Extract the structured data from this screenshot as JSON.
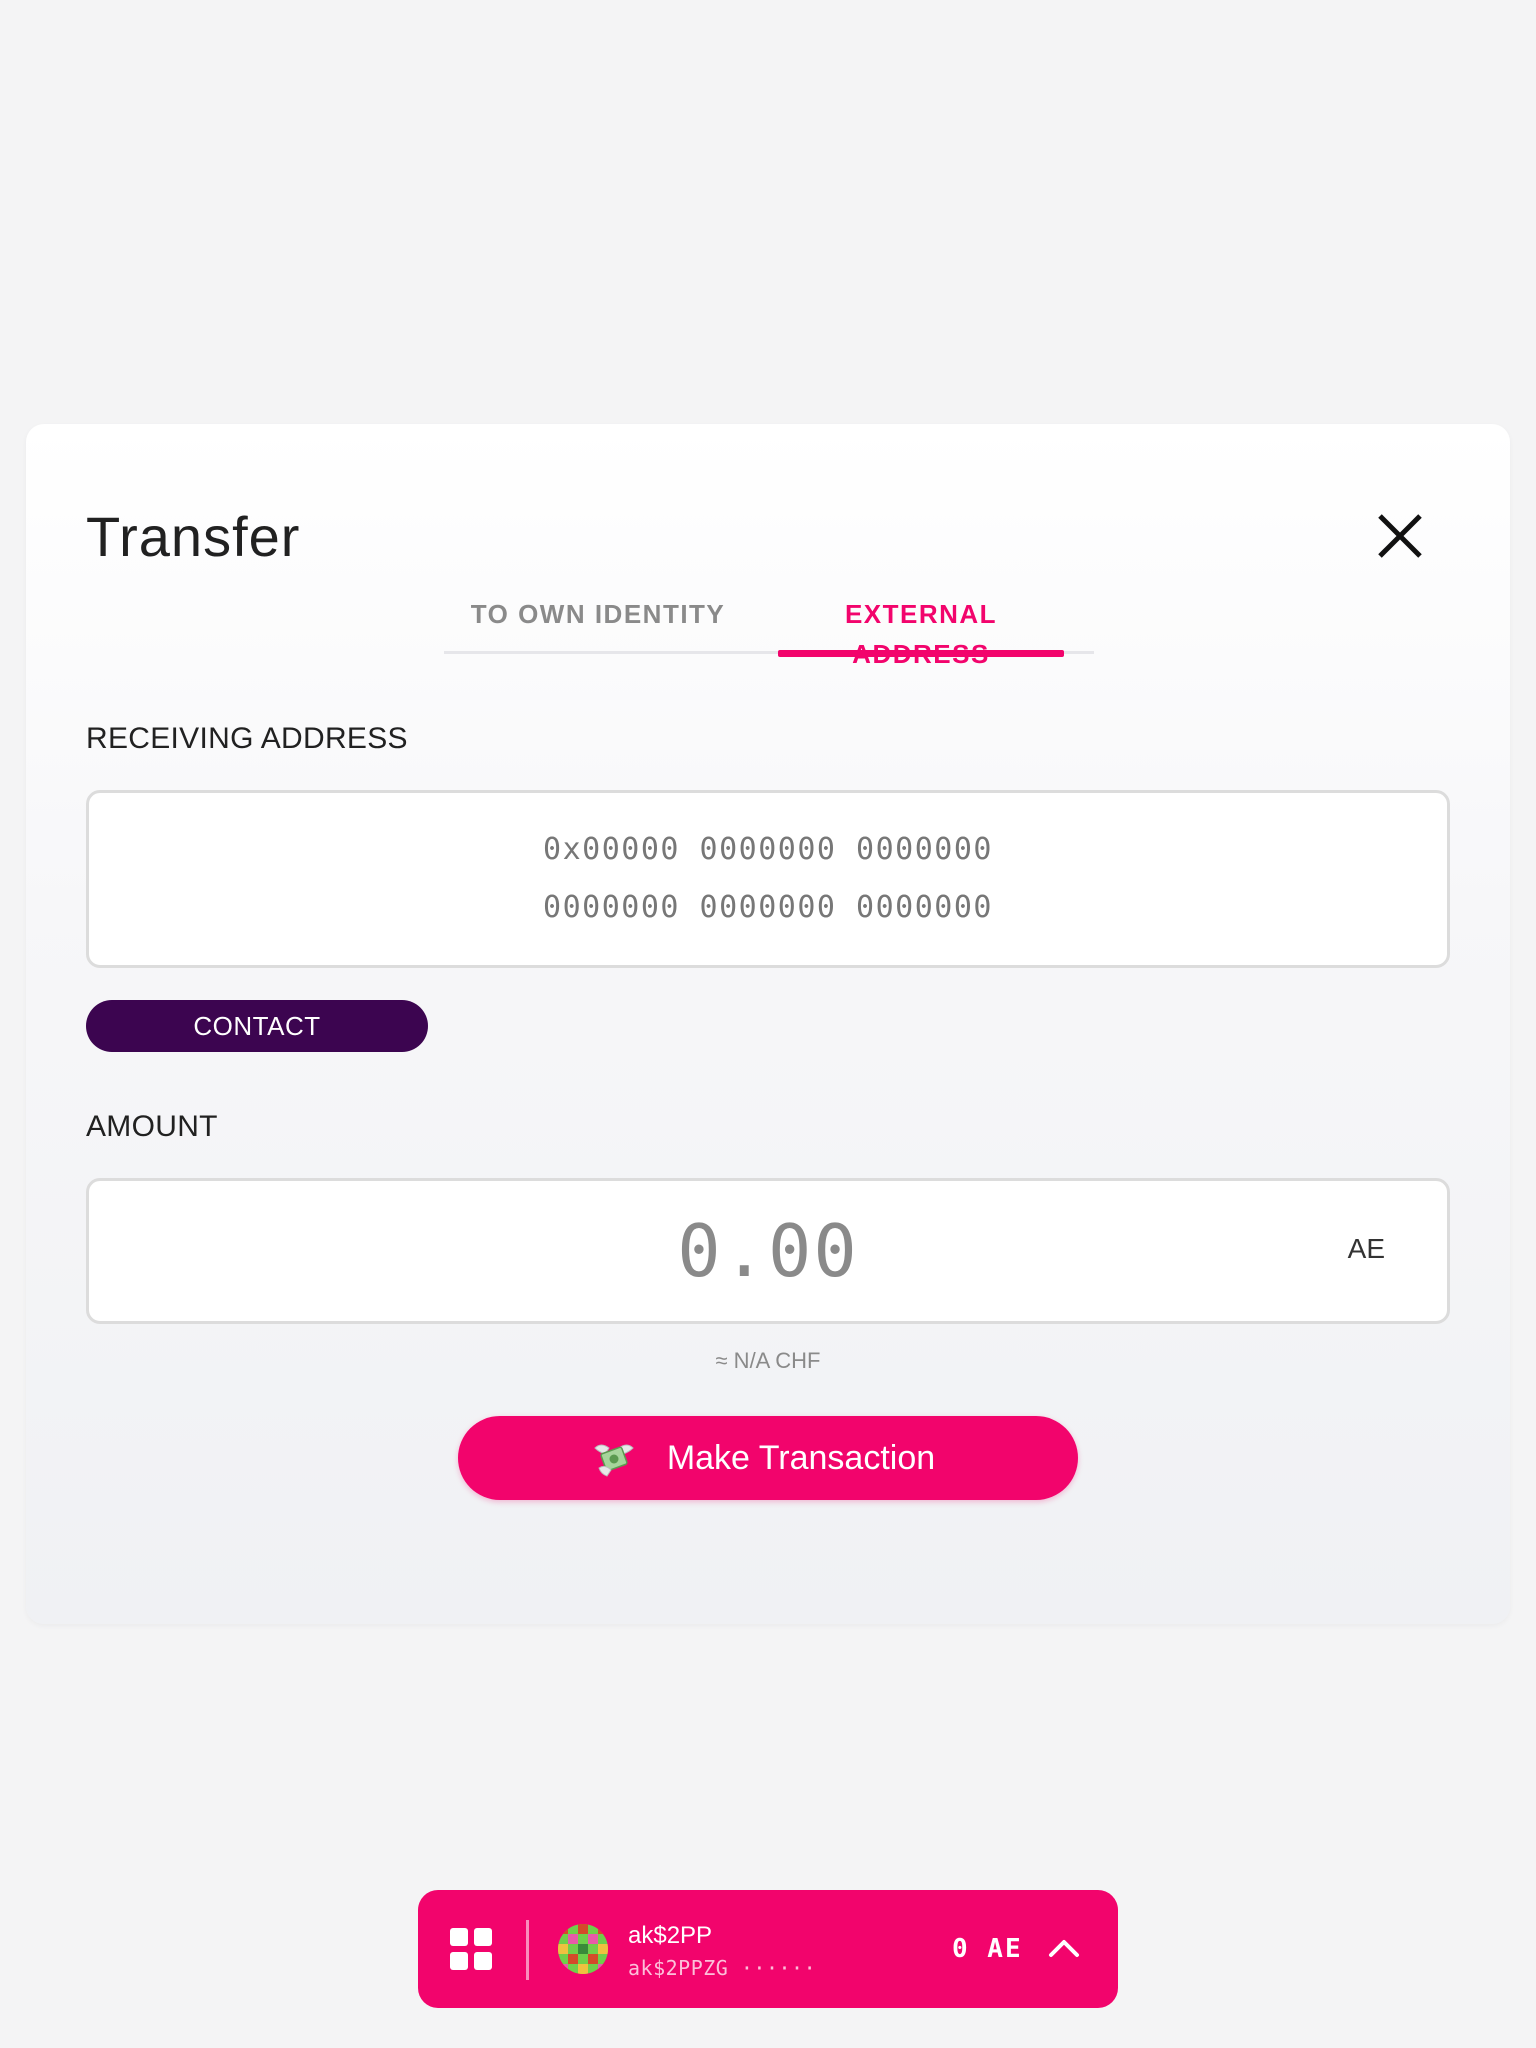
{
  "modal": {
    "title": "Transfer",
    "tabs": [
      {
        "label": "TO OWN IDENTITY",
        "active": false
      },
      {
        "label": "EXTERNAL ADDRESS",
        "active": true
      }
    ],
    "receiving_label": "RECEIVING ADDRESS",
    "address_placeholder_line1": "0x00000 0000000 0000000",
    "address_placeholder_line2": "0000000 0000000 0000000",
    "contact_button": "CONTACT",
    "amount_label": "AMOUNT",
    "amount_placeholder": "0.00",
    "amount_unit": "AE",
    "fiat_estimate": "≈ N/A CHF",
    "submit_button": "Make Transaction",
    "submit_icon": "money-with-wings-icon",
    "close_icon": "close-icon"
  },
  "account_bar": {
    "menu_icon": "grid-icon",
    "name": "ak$2PP",
    "address": "ak$2PPZG ······",
    "balance": "0 AE",
    "expand_icon": "chevron-up-icon"
  },
  "colors": {
    "accent": "#f2046c",
    "contact_button": "#3c0550",
    "background": "#f4f4f5"
  }
}
